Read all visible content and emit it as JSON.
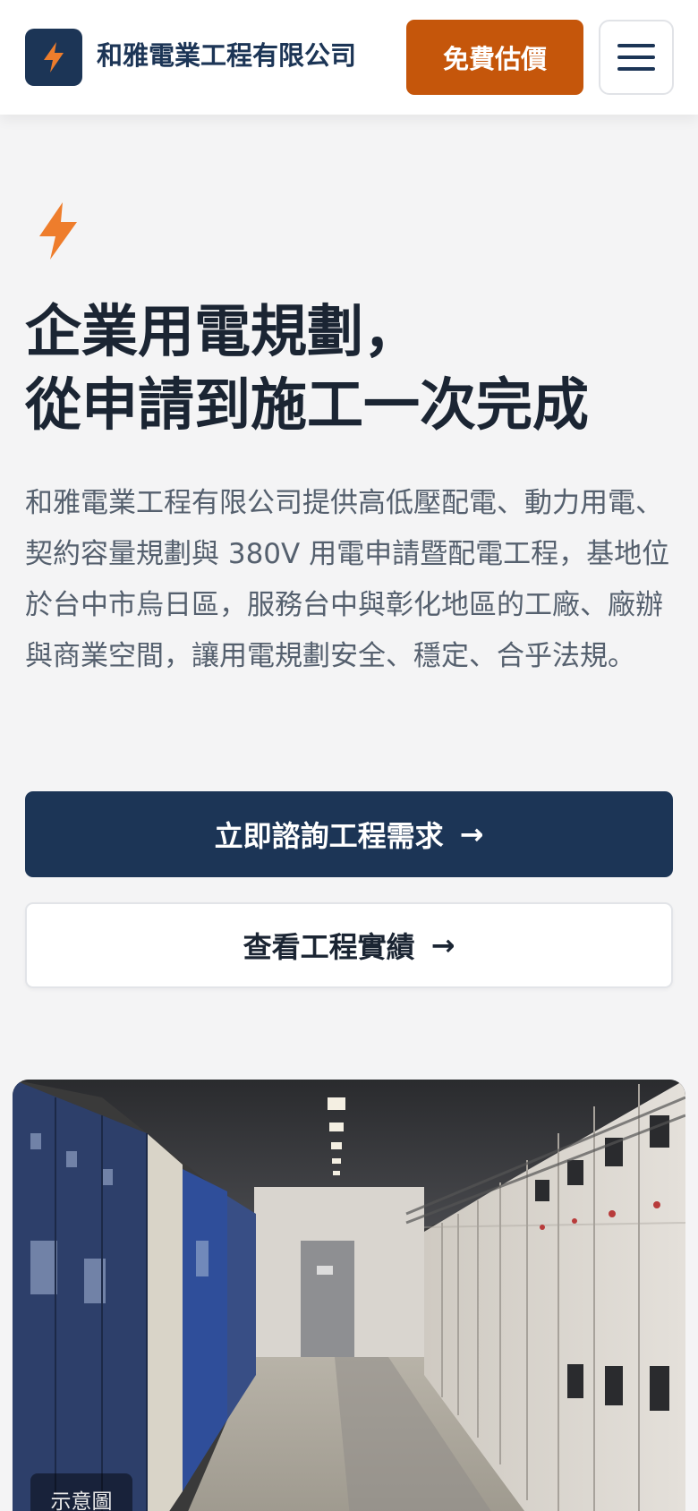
{
  "header": {
    "brand_name": "和雅電業工程有限公司",
    "quote_button": "免費估價",
    "logo_icon": "lightning-bolt-icon",
    "menu_icon": "hamburger-menu-icon"
  },
  "hero": {
    "icon": "lightning-bolt-icon",
    "title_line1": "企業用電規劃，",
    "title_line2": "從申請到施工一次完成",
    "description": "和雅電業工程有限公司提供高低壓配電、動力用電、契約容量規劃與 380V 用電申請暨配電工程，基地位於台中市烏日區，服務台中與彰化地區的工廠、廠辦與商業空間，讓用電規劃安全、穩定、合乎法規。",
    "primary_button": "立即諮詢工程需求",
    "secondary_button": "查看工程實績",
    "arrow": "→"
  },
  "photo": {
    "caption": "示意圖"
  },
  "colors": {
    "navy": "#1c3556",
    "orange": "#c5560b",
    "bolt": "#ee7d2c",
    "background": "#f4f4f5"
  }
}
